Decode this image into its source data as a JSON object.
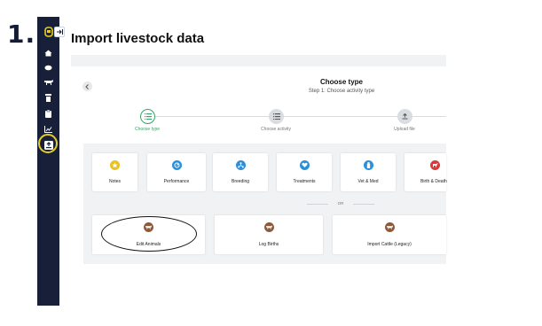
{
  "step_number": "1.",
  "page": {
    "title": "Import livestock data"
  },
  "sidebar": {
    "items": [
      {
        "name": "logo-icon"
      },
      {
        "name": "home-icon"
      },
      {
        "name": "herd-icon"
      },
      {
        "name": "cattle-icon"
      },
      {
        "name": "bin-icon"
      },
      {
        "name": "clipboard-icon"
      },
      {
        "name": "chart-icon"
      },
      {
        "name": "import-icon",
        "active": true
      }
    ]
  },
  "wizard": {
    "title": "Choose type",
    "subtitle": "Step 1: Choose activity type",
    "steps": [
      {
        "label": "Choose type",
        "state": "active",
        "icon": "list-icon"
      },
      {
        "label": "Choose activity",
        "state": "inactive",
        "icon": "list-icon"
      },
      {
        "label": "Upload file",
        "state": "inactive",
        "icon": "upload-icon"
      }
    ]
  },
  "activities": [
    {
      "label": "Notes",
      "color": "#e9c127",
      "icon": "star-icon"
    },
    {
      "label": "Performance",
      "color": "#2d8fd5",
      "icon": "gauge-icon"
    },
    {
      "label": "Breeding",
      "color": "#2d8fd5",
      "icon": "tree-icon"
    },
    {
      "label": "Treatments",
      "color": "#2d8fd5",
      "icon": "heart-icon"
    },
    {
      "label": "Vet & Med",
      "color": "#2d8fd5",
      "icon": "bottle-icon"
    },
    {
      "label": "Birth & Death",
      "color": "#d93a3a",
      "icon": "cross-icon"
    }
  ],
  "divider_text": "OR",
  "other_actions": [
    {
      "label": "Edit Animals",
      "color": "#8b5a3c",
      "icon": "cattle-icon"
    },
    {
      "label": "Log Births",
      "color": "#8b5a3c",
      "icon": "cattle-icon"
    },
    {
      "label": "Import Cattle (Legacy)",
      "color": "#8b5a3c",
      "icon": "cattle-icon"
    }
  ],
  "colors": {
    "sidebar_bg": "#172038",
    "highlight_yellow": "#e5cc24",
    "accent_green": "#3aa36a"
  }
}
